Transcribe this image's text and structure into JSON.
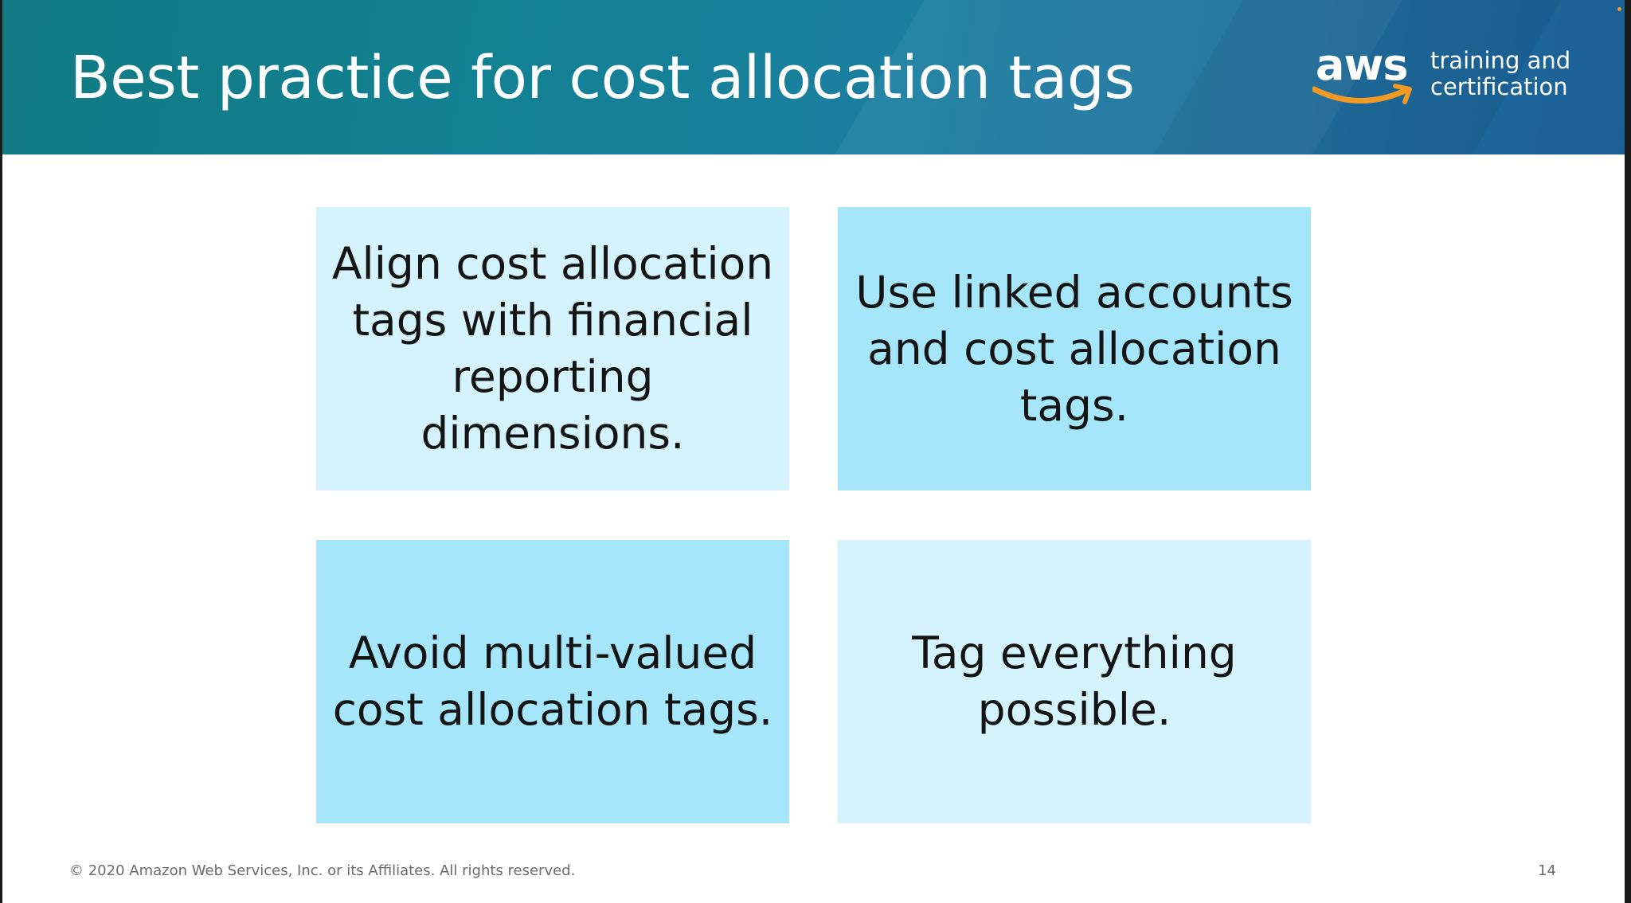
{
  "slide": {
    "title": "Best practice for cost allocation tags",
    "logo": {
      "wordmark": "aws",
      "line1": "training and",
      "line2": "certification",
      "icon": "aws-smile-logo-icon",
      "smile_color": "#f29a23"
    },
    "cards": [
      {
        "text": "Align cost allocation tags with financial reporting dimensions.",
        "color": "#d4f3fc"
      },
      {
        "text": "Use linked accounts and cost allocation tags.",
        "color": "#a5e6fb"
      },
      {
        "text": "Avoid multi-valued cost allocation tags.",
        "color": "#a5e6fb"
      },
      {
        "text": "Tag everything possible.",
        "color": "#d4f3fc"
      }
    ],
    "footer": "© 2020 Amazon Web Services, Inc. or its Affiliates. All rights reserved.",
    "page_number": "14"
  },
  "colors": {
    "header_gradient_start": "#117a83",
    "header_gradient_end": "#1c5f96",
    "title_text": "#ffffff",
    "card_text": "#141414",
    "footer_text": "#6b6b6b"
  }
}
